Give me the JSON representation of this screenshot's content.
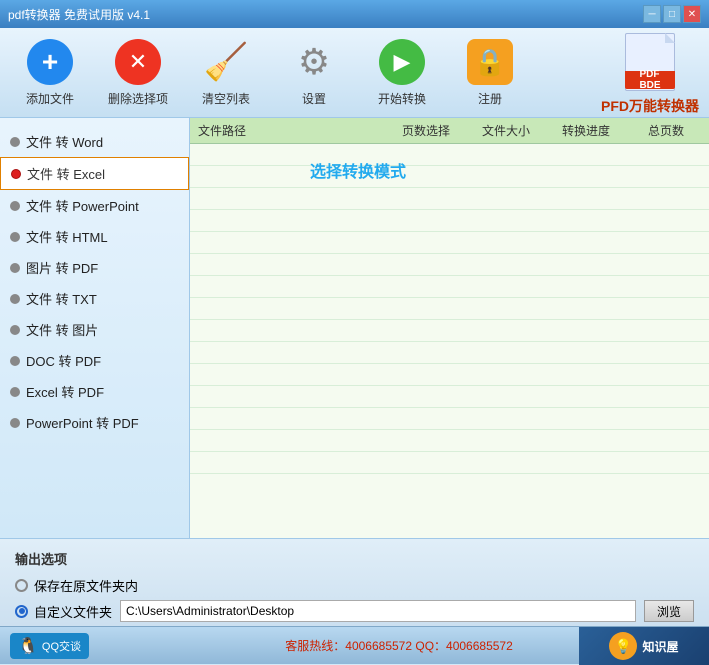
{
  "window": {
    "title": "pdf转换器 免费试用版 v4.1"
  },
  "toolbar": {
    "items": [
      {
        "id": "add-file",
        "label": "添加文件",
        "icon": "add"
      },
      {
        "id": "delete-selected",
        "label": "删除选择项",
        "icon": "delete"
      },
      {
        "id": "clear-list",
        "label": "清空列表",
        "icon": "broom"
      },
      {
        "id": "settings",
        "label": "设置",
        "icon": "gear"
      },
      {
        "id": "start-convert",
        "label": "开始转换",
        "icon": "play"
      },
      {
        "id": "register",
        "label": "注册",
        "icon": "lock"
      }
    ],
    "brand": "PFD万能转换器"
  },
  "table": {
    "headers": [
      "文件路径",
      "页数选择",
      "文件大小",
      "转换进度",
      "总页数"
    ],
    "rows": []
  },
  "sidebar": {
    "items": [
      {
        "label": "文件 转 Word",
        "active": false
      },
      {
        "label": "文件 转 Excel",
        "active": true
      },
      {
        "label": "文件 转 PowerPoint",
        "active": false
      },
      {
        "label": "文件 转 HTML",
        "active": false
      },
      {
        "label": "图片 转 PDF",
        "active": false
      },
      {
        "label": "文件 转 TXT",
        "active": false
      },
      {
        "label": "文件 转 图片",
        "active": false
      },
      {
        "label": "DOC 转 PDF",
        "active": false
      },
      {
        "label": "Excel 转 PDF",
        "active": false
      },
      {
        "label": "PowerPoint 转 PDF",
        "active": false
      }
    ]
  },
  "hint": {
    "select_mode": "选择转换模式"
  },
  "output": {
    "title": "输出选项",
    "option1": "保存在原文件夹内",
    "option2": "自定义文件夹",
    "path": "C:\\Users\\Administrator\\Desktop",
    "browse_btn": "浏览"
  },
  "footer": {
    "qq_label": "QQ交谈",
    "service_text": "客服热线：4006685572 QQ：4006685572",
    "brand": "知识屋",
    "brand_url": "zhishivu.com"
  }
}
